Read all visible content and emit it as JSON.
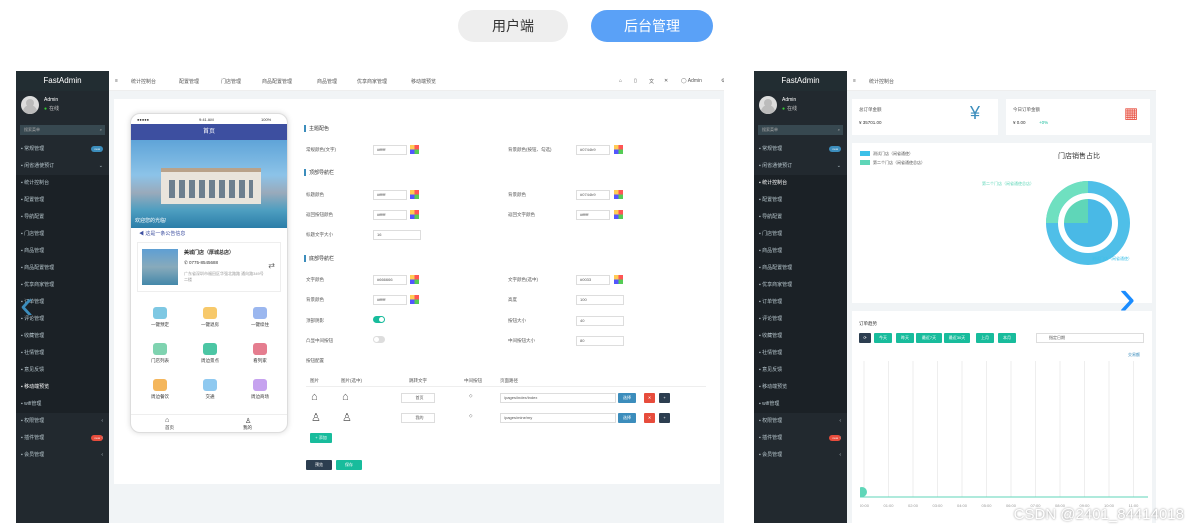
{
  "tabs": {
    "user": "用户端",
    "admin": "后台管理"
  },
  "sidebar": {
    "logo": "FastAdmin",
    "user_name": "Admin",
    "user_status": "在线",
    "search_placeholder": "搜索菜单",
    "items": [
      {
        "label": "常规管理",
        "badge": "new"
      },
      {
        "label": "闲省通使预订"
      },
      {
        "label": "统计控制台"
      },
      {
        "label": "配置管理"
      },
      {
        "label": "导航配置"
      },
      {
        "label": "门店管理"
      },
      {
        "label": "商品管理"
      },
      {
        "label": "商品配置管理"
      },
      {
        "label": "优享商家管理"
      },
      {
        "label": "订单管理"
      },
      {
        "label": "评论管理"
      },
      {
        "label": "收藏管理"
      },
      {
        "label": "社情管理"
      },
      {
        "label": "意见反馈"
      },
      {
        "label": "移动端预览"
      },
      {
        "label": "wifi管理"
      },
      {
        "label": "权限管理"
      },
      {
        "label": "插件管理",
        "badge": "new"
      },
      {
        "label": "会员管理"
      }
    ]
  },
  "topnav1": [
    "统计控制台",
    "配置管理",
    "门店管理",
    "商品配置管理",
    "商品管理",
    "优享商家管理",
    "移动端预览"
  ],
  "topnav_user": "Admin",
  "phone": {
    "time": "9:41 AM",
    "battery": "100%",
    "title": "首页",
    "welcome": "欢迎您的光临!",
    "notice": "这是一条公告信息",
    "store_name": "美城门店（厚城总店）",
    "store_phone": "0775-8545688",
    "store_addr": "广东省深圳市福田区华强北路路 通向路349号二楼",
    "grid": [
      "一键预定",
      "一键退房",
      "一键续住",
      "门店列表",
      "周边景点",
      "看列家",
      "周边餐饮",
      "交通",
      "周边商场"
    ],
    "foot": [
      "首页",
      "我的"
    ]
  },
  "form": {
    "sec_theme": "主题配色",
    "sec_nav": "顶部导航栏",
    "sec_tab": "底部导航栏",
    "labels": [
      "常规颜色(文字)",
      "背景颜色(按钮、勾选)",
      "标题颜色",
      "背景颜色",
      "返回按钮颜色",
      "返回文字颜色",
      "标题文字大小",
      "文字颜色",
      "文字颜色(选中)",
      "背景颜色",
      "高度",
      "顶部阴影",
      "按钮大小",
      "凸显中间按钮",
      "中间按钮大小",
      "按钮配置"
    ],
    "values": [
      "#ffffff",
      "#0744b9",
      "#ffffff",
      "#0744b9",
      "#ffffff",
      "#ffffff",
      "16",
      "#666666",
      "#0033",
      "#ffffff",
      "100",
      "40",
      "80"
    ],
    "table_headers": [
      "图片",
      "图片(选中)",
      "跳转文字",
      "中间按钮",
      "页面路径"
    ],
    "rows": [
      {
        "text": "首页",
        "path": "/pages/index/index"
      },
      {
        "text": "我的",
        "path": "/pages/mine/my"
      }
    ],
    "btn_select": "选择",
    "btn_add": "+ 添加",
    "btn_preview": "预览",
    "btn_save": "保存"
  },
  "dash": {
    "topnav": "统计控制台",
    "total_orders_label": "总订单金额",
    "total_orders_value": "¥ 35701.00",
    "today_label": "今日订单金额",
    "today_value": "¥ 0.00",
    "today_change": "+0%",
    "today_sub": "较门店收入总额",
    "pie_title": "门店销售占比",
    "legend": [
      "测试门店（闲省通使）",
      "第二个门店（闲省通使总店）"
    ],
    "pie_label_1": "第二个门店（闲省通使总店）",
    "pie_label_2": "测试门店（闲省通使）",
    "trend_title": "订单趋势",
    "filters": [
      "今天",
      "昨天",
      "最近7天",
      "最近30天",
      "上月",
      "本月"
    ],
    "date_placeholder": "指定日期",
    "trend_legend": "交易额",
    "xticks": [
      "00:00",
      "01:00",
      "02:00",
      "03:00",
      "04:00",
      "05:00",
      "06:00",
      "07:00",
      "08:00",
      "09:00",
      "10:00",
      "11:00"
    ]
  },
  "watermark": "CSDN @2401_84414018",
  "colors": {
    "primary": "#18bc9c",
    "sidebar": "#22292f",
    "accent": "#5aa1f7",
    "nav": "#3d4fa0"
  }
}
